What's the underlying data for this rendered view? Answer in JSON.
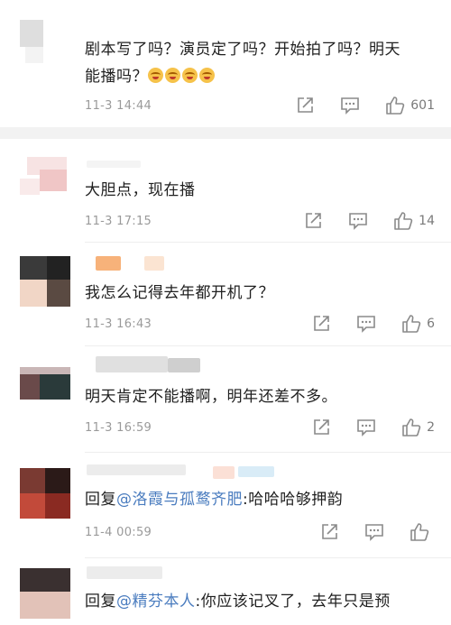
{
  "comments": [
    {
      "text_parts": [
        "剧本写了吗？演员定了吗？开始拍了吗？明天",
        "能播吗？"
      ],
      "emoji_count": 4,
      "time": "11-3 14:44",
      "likes": "601"
    },
    {
      "text": "大胆点，现在播",
      "time": "11-3 17:15",
      "likes": "14"
    },
    {
      "text": "我怎么记得去年都开机了？",
      "time": "11-3 16:43",
      "likes": "6"
    },
    {
      "text": "明天肯定不能播啊，明年还差不多。",
      "time": "11-3 16:59",
      "likes": "2"
    },
    {
      "reply_prefix": "回复",
      "mention": "@洛霞与孤鹜齐肥",
      "reply_text": ":哈哈哈够押韵",
      "time": "11-4 00:59",
      "likes": ""
    },
    {
      "reply_prefix": "回复",
      "mention": "@精芬本人",
      "reply_text": ":你应该记叉了，去年只是预"
    }
  ],
  "icons": {
    "share": "share-icon",
    "comment": "comment-icon",
    "like": "thumbs-up-icon"
  }
}
